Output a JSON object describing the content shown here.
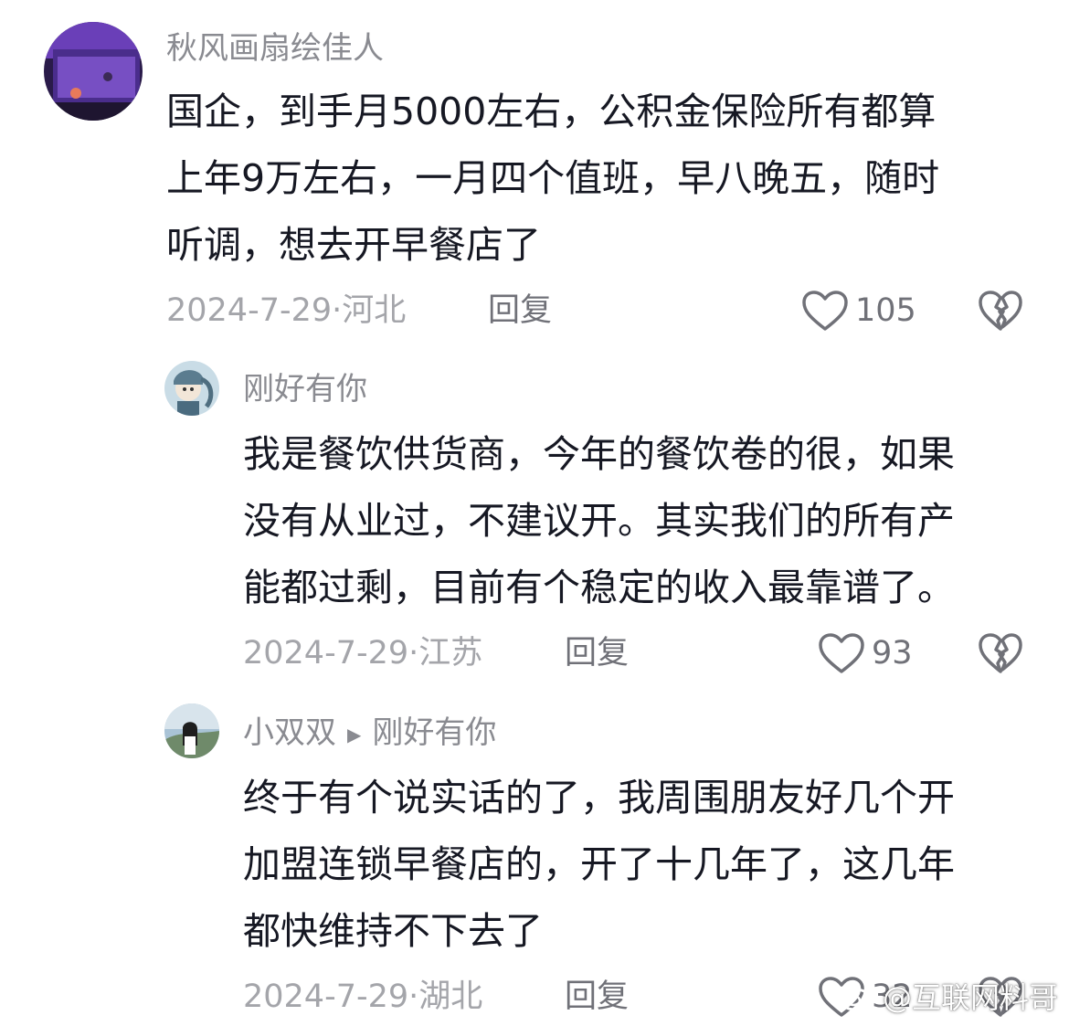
{
  "comments": [
    {
      "username": "秋风画扇绘佳人",
      "lines": [
        "国企，到手月5000左右，公积金保险所有都算",
        "上年9万左右，一月四个值班，早八晚五，随时",
        "听调，想去开早餐店了"
      ],
      "date": "2024-7-29",
      "location": "河北",
      "reply_label": "回复",
      "likes": "105"
    },
    {
      "username": "刚好有你",
      "lines": [
        "我是餐饮供货商，今年的餐饮卷的很，如果",
        "没有从业过，不建议开。其实我们的所有产",
        "能都过剩，目前有个稳定的收入最靠谱了。"
      ],
      "date": "2024-7-29",
      "location": "江苏",
      "reply_label": "回复",
      "likes": "93"
    },
    {
      "username": "小双双",
      "reply_to": "刚好有你",
      "lines": [
        "终于有个说实话的了，我周围朋友好几个开",
        "加盟连锁早餐店的，开了十几年了，这几年",
        "都快维持不下去了"
      ],
      "date": "2024-7-29",
      "location": "湖北",
      "reply_label": "回复",
      "likes": "32"
    }
  ],
  "watermark": {
    "text": "@互联网料哥"
  },
  "colors": {
    "username": "#8a8b91",
    "text": "#161823",
    "meta": "#a4a5aa"
  }
}
